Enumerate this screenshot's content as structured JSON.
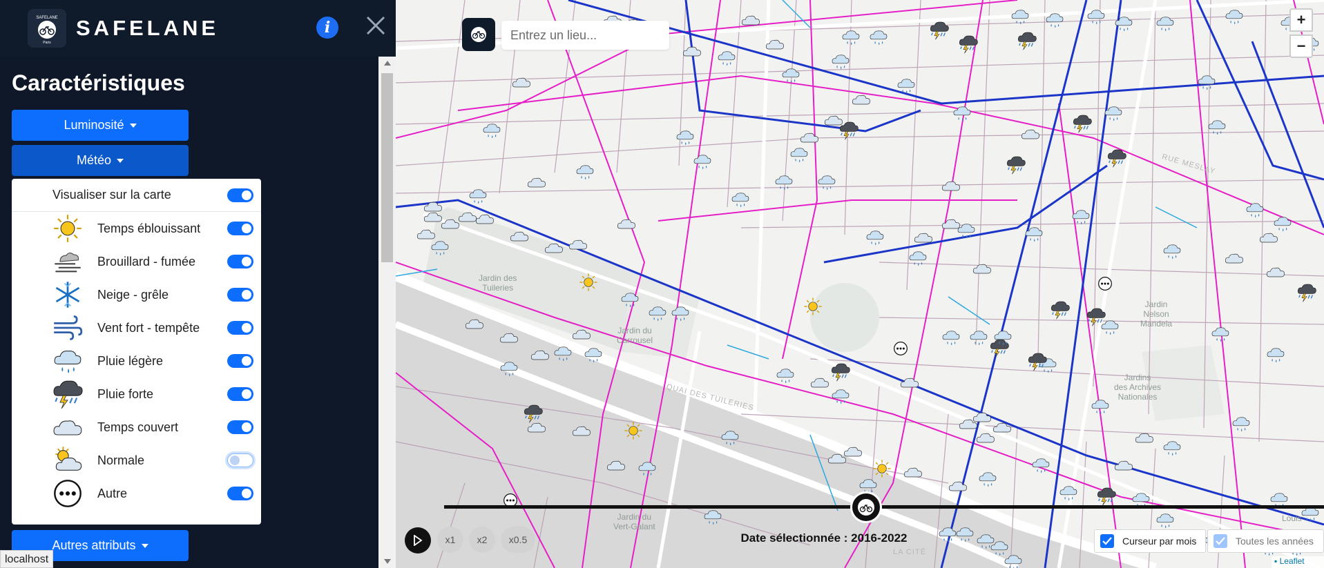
{
  "brand": {
    "name": "SAFELANE",
    "logo_top": "SAFELANE",
    "logo_bottom": "Paris"
  },
  "sidebar": {
    "section_title": "Caractéristiques",
    "dropdowns": {
      "luminosite": "Luminosité",
      "meteo": "Météo",
      "autres": "Autres attributs"
    },
    "meteo_panel": {
      "visualiser_label": "Visualiser sur la carte",
      "visualiser_on": true,
      "items": [
        {
          "label": "Temps éblouissant",
          "icon": "sun-icon",
          "on": true
        },
        {
          "label": "Brouillard - fumée",
          "icon": "fog-icon",
          "on": true
        },
        {
          "label": "Neige - grêle",
          "icon": "snowflake-icon",
          "on": true
        },
        {
          "label": "Vent fort - tempête",
          "icon": "wind-icon",
          "on": true
        },
        {
          "label": "Pluie légère",
          "icon": "light-rain-icon",
          "on": true
        },
        {
          "label": "Pluie forte",
          "icon": "storm-icon",
          "on": true
        },
        {
          "label": "Temps couvert",
          "icon": "cloud-icon",
          "on": true
        },
        {
          "label": "Normale",
          "icon": "partly-sunny-icon",
          "on": false
        },
        {
          "label": "Autre",
          "icon": "ellipsis-icon",
          "on": true
        }
      ]
    }
  },
  "map": {
    "search": {
      "placeholder": "Entrez un lieu..."
    },
    "zoom": {
      "in": "+",
      "out": "−"
    },
    "labels": {
      "jardin_tuileries": "Jardin des\nTuileries",
      "jardin_carrousel": "Jardin du\nCarrousel",
      "jardin_mandela": "Jardin\nNelson\nMandela",
      "jardins_archives": "Jardins\ndes Archives\nNationales",
      "jardin_vert_galant": "Jardin du\nVert-Galant",
      "louis": "Louis",
      "rue_meslay": "RUE MESLAY",
      "quai_tuileries": "QUAI DES TUILERIES",
      "la_cite": "LA CITÉ"
    },
    "timeline": {
      "speeds": [
        "x1",
        "x2",
        "x0.5"
      ],
      "date_label": "Date sélectionnée : 2016-2022",
      "cursor_label": "Curseur par mois",
      "cursor_checked": true,
      "all_years_label": "Toutes les années",
      "all_years_checked": true
    },
    "attribution": "Leaflet"
  },
  "status_bar": "localhost",
  "colors": {
    "accent": "#0d6efd",
    "sidebar_bg": "#0f1a2b",
    "bike_lane_pink": "#e51ec7",
    "bike_lane_blue": "#1c35c9",
    "bike_lane_cyan": "#2aa8e0",
    "street": "#b89cb3"
  }
}
